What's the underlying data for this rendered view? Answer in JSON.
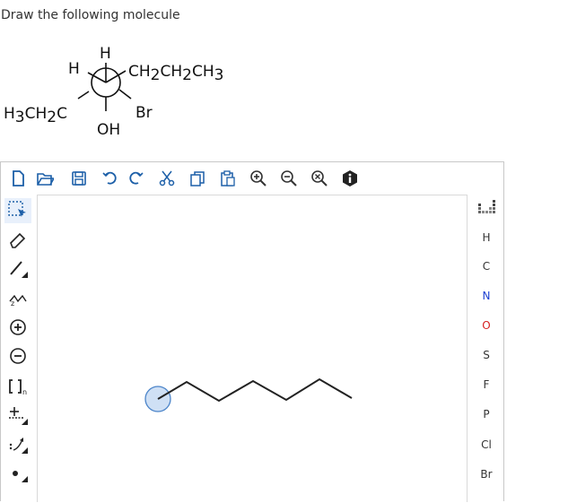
{
  "prompt": "Draw the following molecule",
  "newman": {
    "top": "H",
    "upper_left": "H",
    "upper_right": "CH2CH2CH3",
    "lower_left": "H3CH2C",
    "lower_right": "Br",
    "bottom": "OH"
  },
  "toolbar": [
    {
      "name": "new-document-icon"
    },
    {
      "name": "open-folder-icon"
    },
    {
      "name": "save-icon"
    },
    {
      "name": "undo-icon"
    },
    {
      "name": "redo-icon"
    },
    {
      "name": "cut-icon"
    },
    {
      "name": "copy-icon"
    },
    {
      "name": "paste-icon"
    },
    {
      "name": "zoom-in-icon"
    },
    {
      "name": "zoom-out-icon"
    },
    {
      "name": "zoom-reset-icon"
    },
    {
      "name": "info-icon"
    }
  ],
  "left_tools": [
    {
      "name": "selection-tool-icon"
    },
    {
      "name": "eraser-icon"
    },
    {
      "name": "bond-tool-icon"
    },
    {
      "name": "chain-tool-icon"
    },
    {
      "name": "positive-charge-icon"
    },
    {
      "name": "negative-charge-icon"
    },
    {
      "name": "sgroup-tool-icon",
      "label": "[ ]",
      "sub": "n"
    },
    {
      "name": "reaction-arrow-icon"
    },
    {
      "name": "reaction-mapping-icon"
    },
    {
      "name": "atom-dot-icon"
    }
  ],
  "elements": [
    "H",
    "C",
    "N",
    "O",
    "S",
    "F",
    "P",
    "Cl",
    "Br"
  ],
  "colors": {
    "blue_element": "#1c3fd1",
    "red_element": "#d62020",
    "selection_circle_fill": "#cfe0f5",
    "selection_circle_stroke": "#4b84c9"
  }
}
